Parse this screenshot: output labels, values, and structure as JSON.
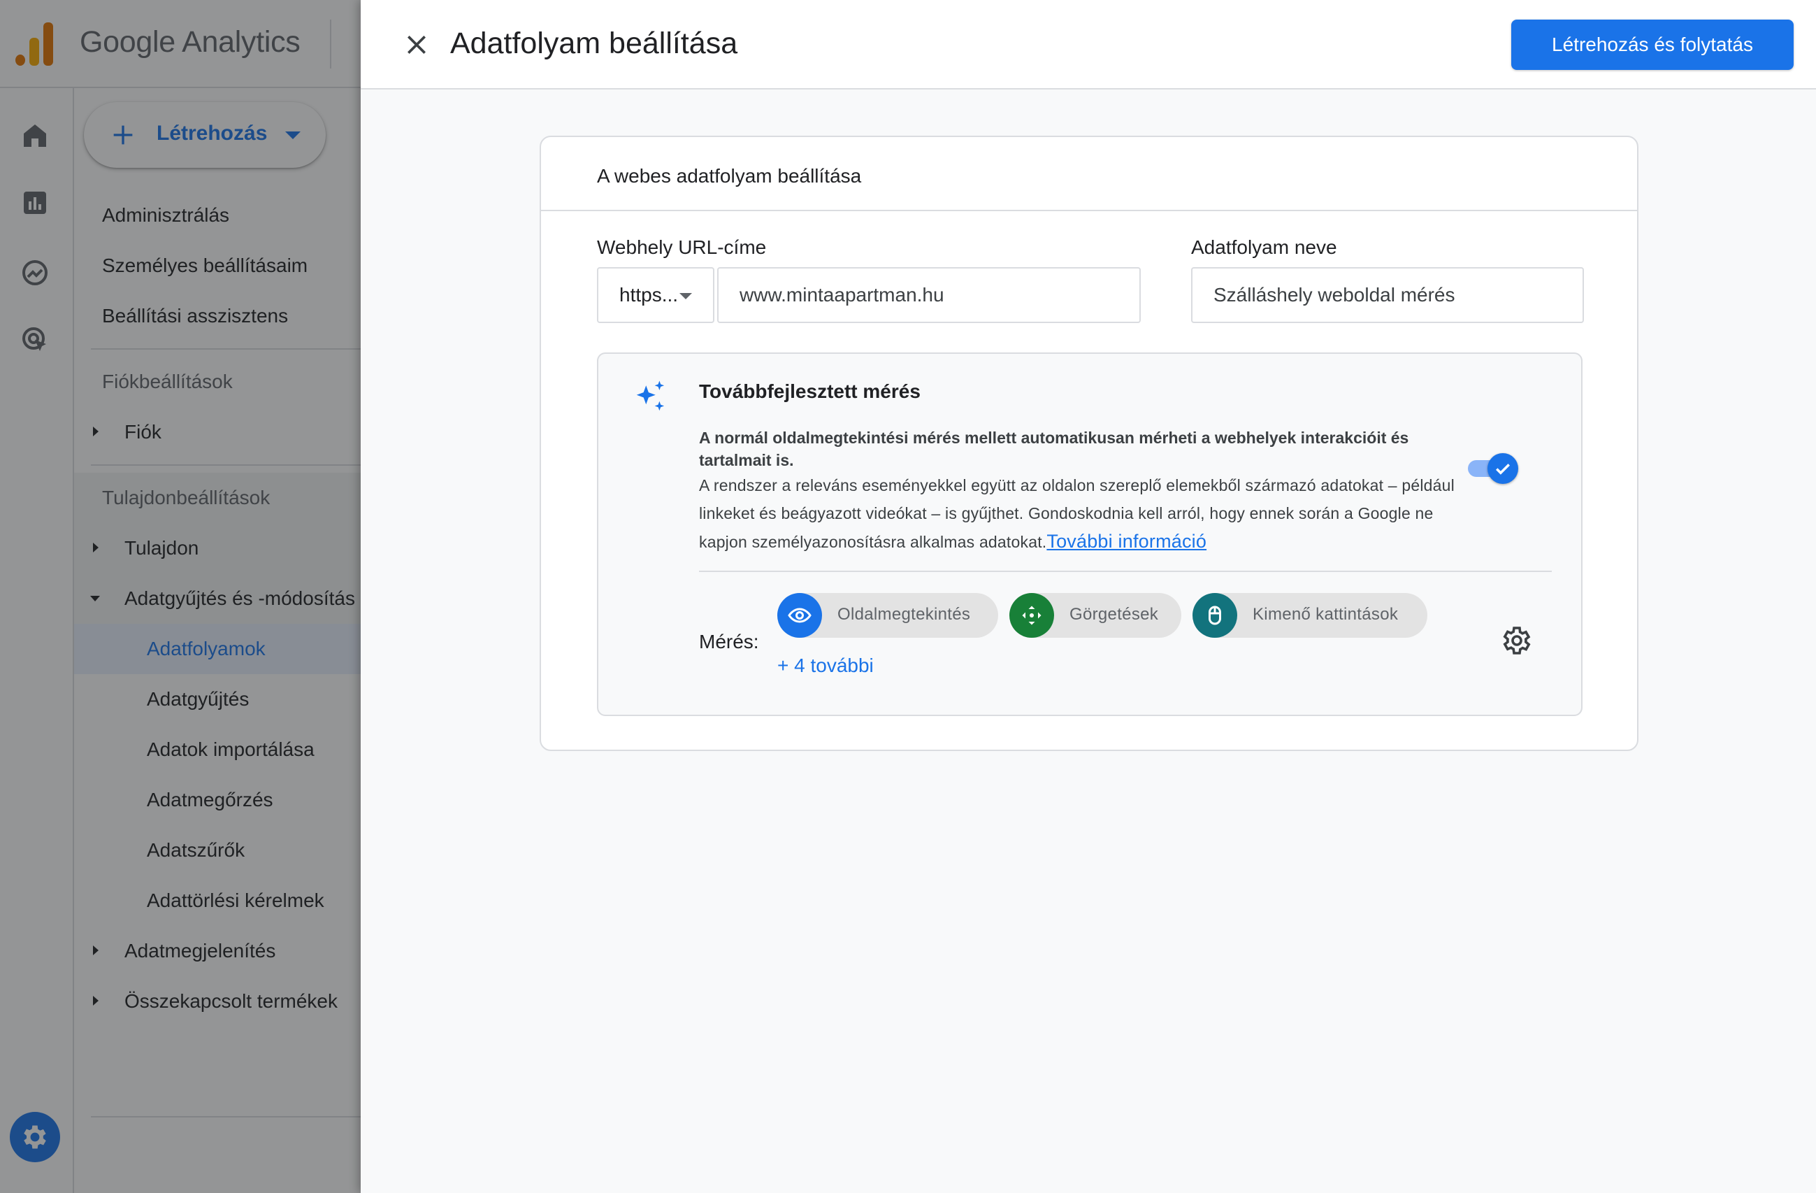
{
  "app": {
    "brand": "Google Analytics",
    "create_label": "Létrehozás"
  },
  "sidebar": {
    "top_items": [
      "Adminisztrálás",
      "Személyes beállításaim",
      "Beállítási asszisztens"
    ],
    "account_section": "Fiókbeállítások",
    "account_item": "Fiók",
    "property_section": "Tulajdonbeállítások",
    "property_item": "Tulajdon",
    "data_group": "Adatgyűjtés és -módosítás",
    "data_items": [
      "Adatfolyamok",
      "Adatgyűjtés",
      "Adatok importálása",
      "Adatmegőrzés",
      "Adatszűrők",
      "Adattörlési kérelmek"
    ],
    "display_item": "Adatmegjelenítés",
    "linked_item": "Összekapcsolt termékek"
  },
  "drawer": {
    "title": "Adatfolyam beállítása",
    "primary_button": "Létrehozás és folytatás",
    "card_title": "A webes adatfolyam beállítása",
    "url_label": "Webhely URL-címe",
    "protocol": "https...",
    "url_value": "www.mintaapartman.hu",
    "name_label": "Adatfolyam neve",
    "name_value": "Szálláshely weboldal mérés",
    "enhanced": {
      "title": "Továbbfejlesztett mérés",
      "desc_bold": "A normál oldalmegtekintési mérés mellett automatikusan mérheti a webhelyek interakcióit és tartalmait is.",
      "desc": "A rendszer a releváns eseményekkel együtt az oldalon szereplő elemekből származó adatokat – például linkeket és beágyazott videókat – is gyűjthet. Gondoskodnia kell arról, hogy ennek során a Google ne kapjon személyazonosításra alkalmas adatokat.",
      "link": "További információ",
      "enabled": true
    },
    "measurement": {
      "label": "Mérés:",
      "chips": [
        {
          "label": "Oldalmegtekintés",
          "icon": "eye-icon",
          "color": "#1a73e8"
        },
        {
          "label": "Görgetések",
          "icon": "scroll-arrows-icon",
          "color": "#188038"
        },
        {
          "label": "Kimenő kattintások",
          "icon": "mouse-icon",
          "color": "#12737d"
        }
      ],
      "more": "+ 4 további"
    }
  },
  "colors": {
    "primary": "#1a73e8",
    "scrim": "#202124"
  }
}
